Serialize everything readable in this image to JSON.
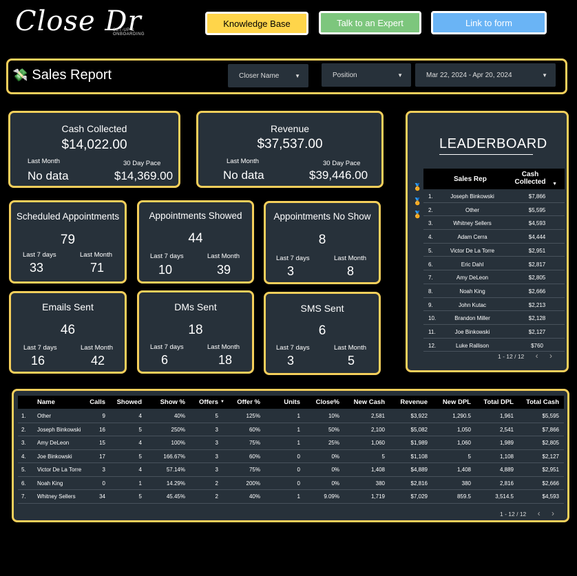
{
  "logo": {
    "script": "Close Dr",
    "tagline": "SET-UP & ONBOARDING"
  },
  "top_buttons": {
    "knowledge_base": "Knowledge Base",
    "expert": "Talk to an Expert",
    "form": "Link to form"
  },
  "header": {
    "icon": "money-wings-icon",
    "title": "Sales Report"
  },
  "filters": {
    "closer": "Closer Name",
    "position": "Position",
    "date_range": "Mar 22, 2024 - Apr 20, 2024"
  },
  "kpis": {
    "cash": {
      "title": "Cash Collected",
      "value": "$14,022.00",
      "sub1_label": "Last Month",
      "sub1_value": "No data",
      "sub2_label": "30 Day Pace",
      "sub2_value": "$14,369.00"
    },
    "revenue": {
      "title": "Revenue",
      "value": "$37,537.00",
      "sub1_label": "Last Month",
      "sub1_value": "No data",
      "sub2_label": "30 Day Pace",
      "sub2_value": "$39,446.00"
    },
    "sched": {
      "title": "Scheduled Appointments",
      "value": "79",
      "sub1_label": "Last 7 days",
      "sub1_value": "33",
      "sub2_label": "Last Month",
      "sub2_value": "71"
    },
    "showed": {
      "title": "Appointments Showed",
      "value": "44",
      "sub1_label": "Last 7 days",
      "sub1_value": "10",
      "sub2_label": "Last Month",
      "sub2_value": "39"
    },
    "noshow": {
      "title": "Appointments No Show",
      "value": "8",
      "sub1_label": "Last 7 days",
      "sub1_value": "3",
      "sub2_label": "Last Month",
      "sub2_value": "8"
    },
    "emails": {
      "title": "Emails Sent",
      "value": "46",
      "sub1_label": "Last 7 days",
      "sub1_value": "16",
      "sub2_label": "Last Month",
      "sub2_value": "42"
    },
    "dms": {
      "title": "DMs Sent",
      "value": "18",
      "sub1_label": "Last 7 days",
      "sub1_value": "6",
      "sub2_label": "Last Month",
      "sub2_value": "18"
    },
    "sms": {
      "title": "SMS Sent",
      "value": "6",
      "sub1_label": "Last 7 days",
      "sub1_value": "3",
      "sub2_label": "Last Month",
      "sub2_value": "5"
    }
  },
  "leaderboard": {
    "title": "LEADERBOARD",
    "col_rep": "Sales Rep",
    "col_cash": "Cash Collected",
    "sort_icon": "caret-down-icon",
    "medals": [
      "gold-medal-icon",
      "silver-medal-icon",
      "bronze-medal-icon"
    ],
    "rows": [
      {
        "n": "1.",
        "name": "Joseph Binkowski",
        "cash": "$7,866"
      },
      {
        "n": "2.",
        "name": "Other",
        "cash": "$5,595"
      },
      {
        "n": "3.",
        "name": "Whitney Sellers",
        "cash": "$4,593"
      },
      {
        "n": "4.",
        "name": "Adam Cerra",
        "cash": "$4,444"
      },
      {
        "n": "5.",
        "name": "Victor De La Torre",
        "cash": "$2,951"
      },
      {
        "n": "6.",
        "name": "Eric Dahl",
        "cash": "$2,817"
      },
      {
        "n": "7.",
        "name": "Amy DeLeon",
        "cash": "$2,805"
      },
      {
        "n": "8.",
        "name": "Noah King",
        "cash": "$2,666"
      },
      {
        "n": "9.",
        "name": "John Kutac",
        "cash": "$2,213"
      },
      {
        "n": "10.",
        "name": "Brandon Miller",
        "cash": "$2,128"
      },
      {
        "n": "11.",
        "name": "Joe Binkowski",
        "cash": "$2,127"
      },
      {
        "n": "12.",
        "name": "Luke Rallison",
        "cash": "$760"
      }
    ],
    "pager": "1 - 12 / 12"
  },
  "table": {
    "headers": [
      "Name",
      "Calls",
      "Showed",
      "Show %",
      "Offers",
      "Offer %",
      "Units",
      "Close%",
      "New Cash",
      "Revenue",
      "New DPL",
      "Total DPL",
      "Total Cash"
    ],
    "sort_icon": "caret-down-icon",
    "rows": [
      [
        "1.",
        "Other",
        "9",
        "4",
        "40%",
        "5",
        "125%",
        "1",
        "10%",
        "2,581",
        "$3,922",
        "1,290.5",
        "1,961",
        "$5,595"
      ],
      [
        "2.",
        "Joseph Binkowski",
        "16",
        "5",
        "250%",
        "3",
        "60%",
        "1",
        "50%",
        "2,100",
        "$5,082",
        "1,050",
        "2,541",
        "$7,866"
      ],
      [
        "3.",
        "Amy DeLeon",
        "15",
        "4",
        "100%",
        "3",
        "75%",
        "1",
        "25%",
        "1,060",
        "$1,989",
        "1,060",
        "1,989",
        "$2,805"
      ],
      [
        "4.",
        "Joe Binkowski",
        "17",
        "5",
        "166.67%",
        "3",
        "60%",
        "0",
        "0%",
        "5",
        "$1,108",
        "5",
        "1,108",
        "$2,127"
      ],
      [
        "5.",
        "Victor De La Torre",
        "3",
        "4",
        "57.14%",
        "3",
        "75%",
        "0",
        "0%",
        "1,408",
        "$4,889",
        "1,408",
        "4,889",
        "$2,951"
      ],
      [
        "6.",
        "Noah King",
        "0",
        "1",
        "14.29%",
        "2",
        "200%",
        "0",
        "0%",
        "380",
        "$2,816",
        "380",
        "2,816",
        "$2,666"
      ],
      [
        "7.",
        "Whitney Sellers",
        "34",
        "5",
        "45.45%",
        "2",
        "40%",
        "1",
        "9.09%",
        "1,719",
        "$7,029",
        "859.5",
        "3,514.5",
        "$4,593"
      ]
    ],
    "pager": "1 - 12 / 12"
  }
}
